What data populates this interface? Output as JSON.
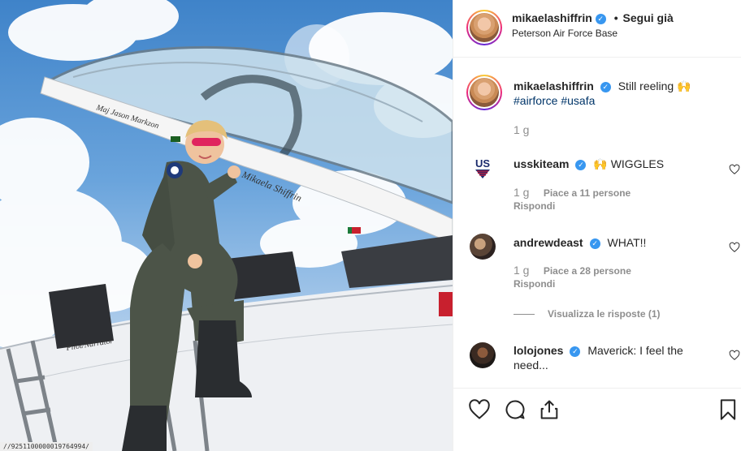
{
  "post": {
    "author": "mikaelashiffrin",
    "follow_separator": "•",
    "follow_status": "Segui già",
    "location": "Peterson Air Force Base",
    "overlay_url": "//9251100000019764994/",
    "canopy_name": "Maj Jason Markzon",
    "pilot_name": "Mikaela Shiffrin",
    "fuselage_text": "Pilot/Narrator"
  },
  "caption": {
    "username": "mikaelashiffrin",
    "text": "Still reeling",
    "emoji": "🙌",
    "hashtag1": "#airforce",
    "hashtag2": "#usafa",
    "time": "1 g"
  },
  "comments": [
    {
      "username": "usskiteam",
      "emoji": "🙌",
      "text": "WIGGLES",
      "time": "1 g",
      "likes": "Piace a 11 persone",
      "reply": "Rispondi",
      "avatar_text": "US"
    },
    {
      "username": "andrewdeast",
      "text": "WHAT!!",
      "time": "1 g",
      "likes": "Piace a 28 persone",
      "reply": "Rispondi",
      "view_replies": "Visualizza le risposte (1)"
    },
    {
      "username": "lolojones",
      "text": "Maverick: I feel the need..."
    }
  ],
  "icons": {
    "verified": "✓",
    "like": "heart-icon",
    "comment": "comment-icon",
    "share": "share-icon",
    "save": "bookmark-icon"
  },
  "colors": {
    "verified_blue": "#3897f0",
    "hashtag": "#003569",
    "muted": "#8e8e8e"
  }
}
